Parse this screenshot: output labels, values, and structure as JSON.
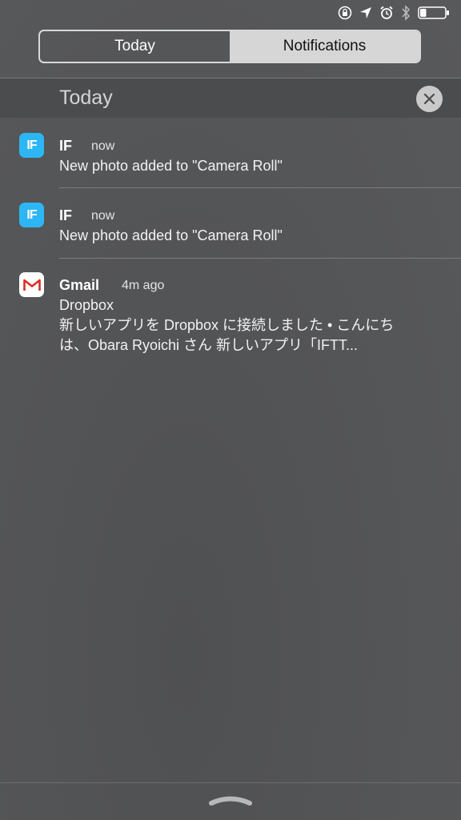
{
  "status_bar": {
    "icons": [
      "orientation-lock-icon",
      "location-arrow-icon",
      "alarm-icon",
      "bluetooth-icon",
      "battery-icon"
    ],
    "battery_level": 0.25
  },
  "segmented": {
    "tabs": [
      {
        "label": "Today",
        "selected": false
      },
      {
        "label": "Notifications",
        "selected": true
      }
    ]
  },
  "section": {
    "title": "Today",
    "clear_icon": "close-icon"
  },
  "notifications": [
    {
      "app": "IF",
      "time": "now",
      "lines": [
        "New photo added to \"Camera Roll\""
      ],
      "icon": "if-app-icon"
    },
    {
      "app": "IF",
      "time": "now",
      "lines": [
        "New photo added to \"Camera Roll\""
      ],
      "icon": "if-app-icon"
    },
    {
      "app": "Gmail",
      "time": "4m ago",
      "lines": [
        "Dropbox",
        "新しいアプリを Dropbox に接続しました  •  こんにち",
        "は、Obara Ryoichi さん 新しいアプリ「IFTT..."
      ],
      "icon": "gmail-app-icon"
    }
  ],
  "colors": {
    "if_icon": "#2db6f4",
    "gmail_red": "#d93025",
    "background": "#58595b"
  },
  "footer": {
    "grabber_icon": "chevron-up-icon"
  }
}
